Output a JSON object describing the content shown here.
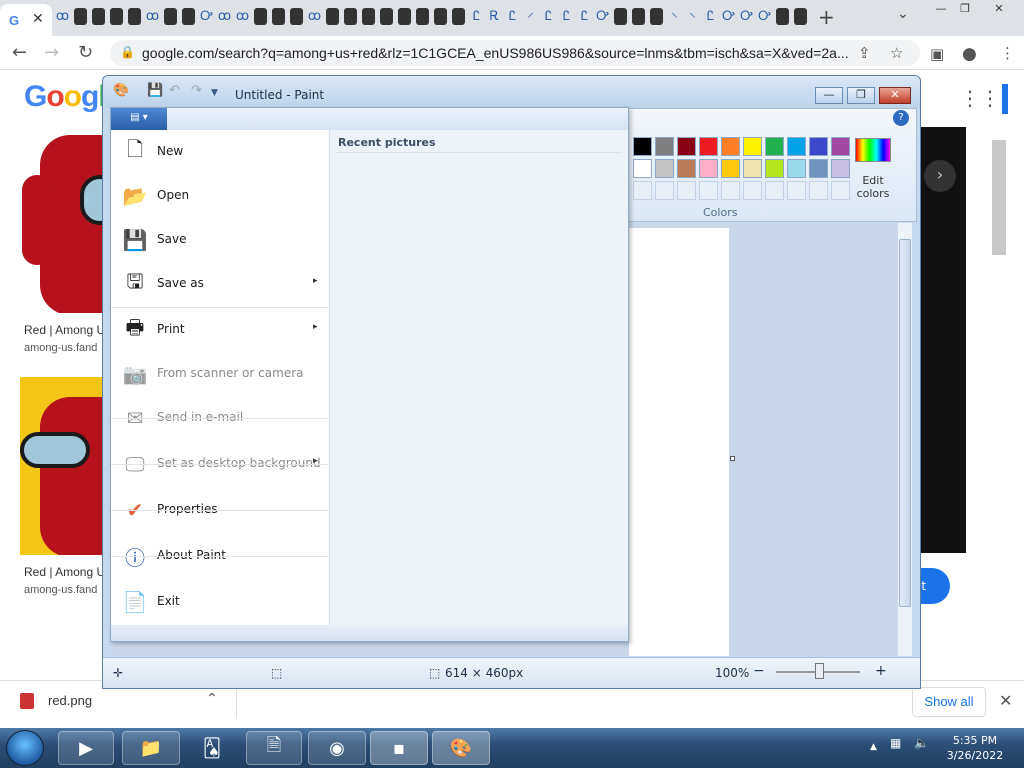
{
  "browser": {
    "active_tab_close": "✕",
    "new_tab": "+",
    "tab_list": "⌄",
    "window_controls": [
      "—",
      "❐",
      "✕"
    ],
    "nav": {
      "back": "←",
      "forward": "→",
      "reload": "↻"
    },
    "url": "google.com/search?q=among+us+red&rlz=1C1GCEA_enUS986US986&source=lnms&tbm=isch&sa=X&ved=2a...",
    "omni_icons": [
      "share-icon",
      "star-icon",
      "sidebar-icon",
      "profile-icon",
      "menu-icon"
    ]
  },
  "page": {
    "logo": "Google",
    "results": [
      {
        "title": "Red | Among U",
        "source": "among-us.fand"
      },
      {
        "title": "Red | Among U",
        "source": "among-us.fand"
      }
    ],
    "preview_next": "›",
    "visit_label": "it"
  },
  "downloads": {
    "file_name": "red.png",
    "show_all": "Show all",
    "close": "✕"
  },
  "paint": {
    "title": "Untitled - Paint",
    "titlebar_buttons": [
      "—",
      "❐",
      "✕"
    ],
    "colors_label": "Colors",
    "edit_colors": "Edit colors",
    "palette_row1": [
      "#000000",
      "#7f7f7f",
      "#880015",
      "#ed1c24",
      "#ff7f27",
      "#fff200",
      "#22b14c",
      "#00a2e8",
      "#3f48cc",
      "#a349a4"
    ],
    "palette_row2": [
      "#ffffff",
      "#c3c3c3",
      "#b97a57",
      "#ffaec9",
      "#ffc90e",
      "#efe4b0",
      "#b5e61d",
      "#99d9ea",
      "#7092be",
      "#c8bfe7"
    ],
    "status": {
      "dimensions": "614 × 460px",
      "zoom": "100%",
      "zoom_out": "−",
      "zoom_in": "+"
    },
    "file_menu": {
      "recent_header": "Recent pictures",
      "items": [
        {
          "label": "New",
          "icon": "new-document-icon",
          "disabled": false,
          "submenu": false
        },
        {
          "label": "Open",
          "icon": "open-folder-icon",
          "disabled": false,
          "submenu": false
        },
        {
          "label": "Save",
          "icon": "save-disk-icon",
          "disabled": false,
          "submenu": false
        },
        {
          "label": "Save as",
          "icon": "save-as-icon",
          "disabled": false,
          "submenu": true
        },
        {
          "label": "Print",
          "icon": "printer-icon",
          "disabled": false,
          "submenu": true
        },
        {
          "label": "From scanner or camera",
          "icon": "scanner-icon",
          "disabled": true,
          "submenu": false
        },
        {
          "label": "Send in e-mail",
          "icon": "email-icon",
          "disabled": true,
          "submenu": false
        },
        {
          "label": "Set as desktop background",
          "icon": "desktop-icon",
          "disabled": true,
          "submenu": true
        },
        {
          "label": "Properties",
          "icon": "checkmark-icon",
          "disabled": false,
          "submenu": false
        },
        {
          "label": "About Paint",
          "icon": "info-icon",
          "disabled": false,
          "submenu": false
        },
        {
          "label": "Exit",
          "icon": "exit-icon",
          "disabled": false,
          "submenu": false
        }
      ],
      "submenu_arrow": "▸"
    }
  },
  "taskbar": {
    "items": [
      "media-player-icon",
      "file-explorer-icon",
      "solitaire-icon",
      "notepad-icon",
      "chrome-icon",
      "cmd-icon",
      "paint-icon"
    ],
    "time": "5:35 PM",
    "date": "3/26/2022",
    "tray_arrow": "▲"
  }
}
